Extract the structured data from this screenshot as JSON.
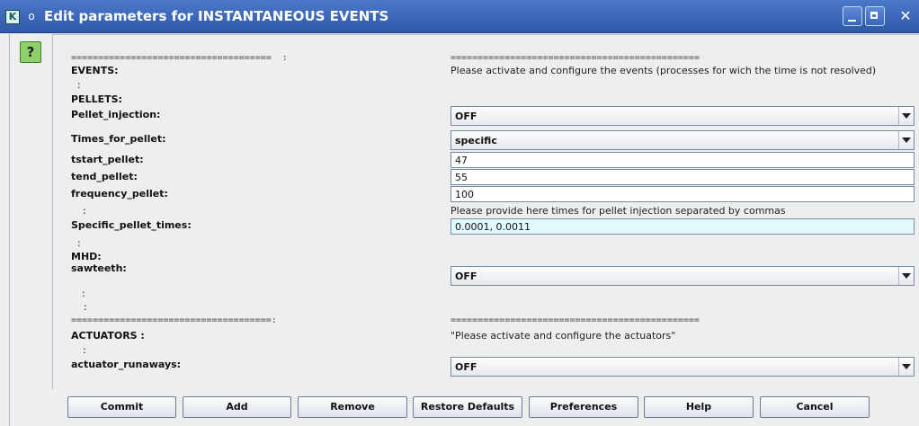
{
  "window": {
    "title": "Edit parameters for INSTANTANEOUS EVENTS",
    "app_icon_letter": "K",
    "menu_glyph": "o",
    "close_glyph": "✕"
  },
  "help_label": "?",
  "separator_left": "=====================================  :",
  "separator_right": "==============================================",
  "separator_left_2": "=====================================:",
  "separator_right_2": "==============================================",
  "colon": ":",
  "sections": {
    "events": {
      "label": "EVENTS:",
      "description": "Please activate and configure the events (processes for wich the time is not resolved)"
    },
    "pellets_label": "PELLETS:",
    "mhd_label": "MHD:",
    "actuators": {
      "label": "ACTUATORS :",
      "description": "\"Please activate and configure the actuators\""
    }
  },
  "params": {
    "pellet_injection": {
      "label": "Pellet_injection:",
      "value": "OFF"
    },
    "times_for_pellet": {
      "label": "Times_for_pellet:",
      "value": "specific"
    },
    "tstart_pellet": {
      "label": "tstart_pellet:",
      "value": "47"
    },
    "tend_pellet": {
      "label": "tend_pellet:",
      "value": "55"
    },
    "frequency_pellet": {
      "label": "frequency_pellet:",
      "value": "100"
    },
    "specific_pellet_times": {
      "label": "Specific_pellet_times:",
      "hint": "Please provide here times for pellet injection separated by commas",
      "value": "0.0001, 0.0011"
    },
    "sawteeth": {
      "label": "sawteeth:",
      "value": "OFF"
    },
    "actuator_runaways": {
      "label": "actuator_runaways:",
      "value": "OFF"
    }
  },
  "buttons": {
    "commit": "Commit",
    "add": "Add",
    "remove": "Remove",
    "restore_defaults": "Restore Defaults",
    "preferences": "Preferences",
    "help": "Help",
    "cancel": "Cancel"
  },
  "colors": {
    "titlebar": "#2f5aa8",
    "help_green": "#8fd06a",
    "highlight_field": "#e2fafc"
  }
}
